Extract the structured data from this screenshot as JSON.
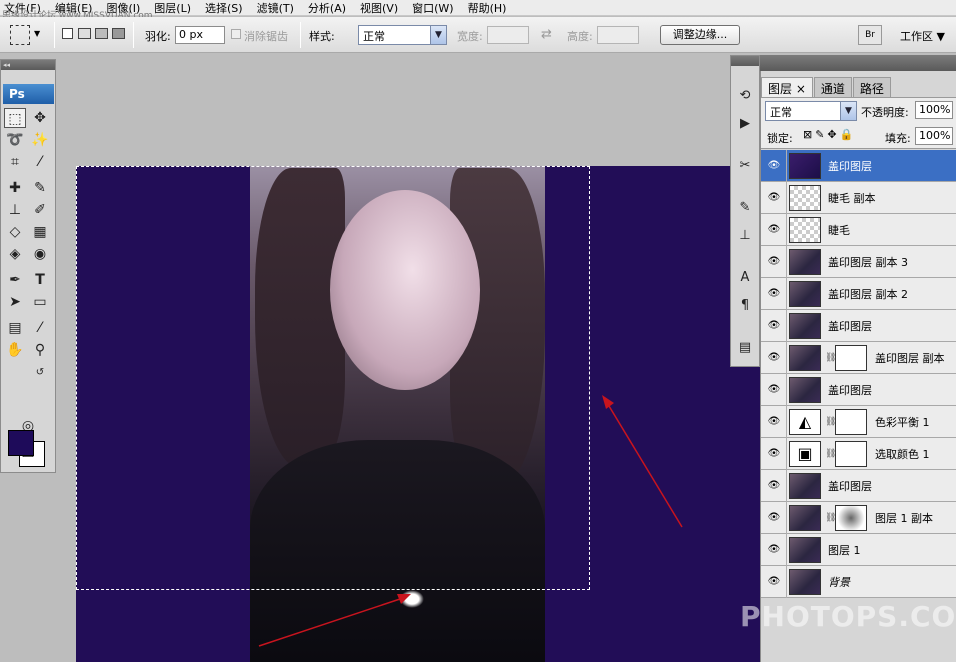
{
  "menu": [
    "文件(F)",
    "编辑(E)",
    "图像(I)",
    "图层(L)",
    "选择(S)",
    "滤镜(T)",
    "分析(A)",
    "视图(V)",
    "窗口(W)",
    "帮助(H)"
  ],
  "watermark_top": "思缘设计论坛 www.MISSVUAN.com",
  "options": {
    "feather_label": "羽化:",
    "feather_value": "0 px",
    "antialias_label": "消除锯齿",
    "style_label": "样式:",
    "style_value": "正常",
    "width_label": "宽度:",
    "height_label": "高度:",
    "refine_button": "调整边缘...",
    "workspace_button": "工作区 ▼"
  },
  "toolbox": {
    "logo": "Ps"
  },
  "layers_panel": {
    "tabs": [
      "图层 ×",
      "通道",
      "路径"
    ],
    "blend_mode": "正常",
    "opacity_label": "不透明度:",
    "opacity_value": "100%",
    "lock_label": "锁定:",
    "fill_label": "填充:",
    "fill_value": "100%",
    "layers": [
      {
        "name": "盖印图层",
        "selected": true
      },
      {
        "name": "睫毛 副本"
      },
      {
        "name": "睫毛"
      },
      {
        "name": "盖印图层 副本 3"
      },
      {
        "name": "盖印图层 副本 2"
      },
      {
        "name": "盖印图层"
      },
      {
        "name": "盖印图层 副本"
      },
      {
        "name": "盖印图层"
      },
      {
        "name": "色彩平衡 1"
      },
      {
        "name": "选取颜色 1"
      },
      {
        "name": "盖印图层"
      },
      {
        "name": "图层 1 副本"
      },
      {
        "name": "图层 1"
      },
      {
        "name": "背景"
      }
    ]
  },
  "colors": {
    "foreground": "#1e0b5a",
    "background": "#ffffff",
    "canvas": "#220d57",
    "selected_row": "#3b6fc4"
  },
  "watermark_bottom": "PHOTOPS.COM"
}
